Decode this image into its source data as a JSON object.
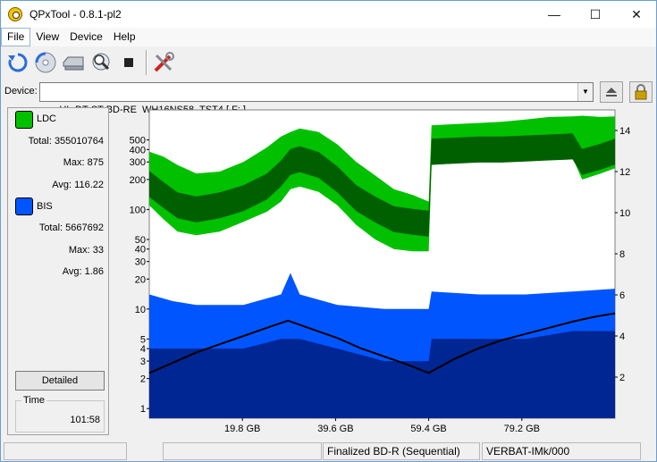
{
  "window": {
    "title": "QPxTool - 0.8.1-pl2"
  },
  "titlebar_buttons": {
    "minimize": "—",
    "maximize": "☐",
    "close": "✕"
  },
  "menu": [
    {
      "label": "File"
    },
    {
      "label": "View"
    },
    {
      "label": "Device"
    },
    {
      "label": "Help"
    }
  ],
  "toolbar": {
    "icons": [
      "refresh-icon",
      "disc-scan-icon",
      "drive-info-icon",
      "magnify-icon",
      "stop-icon",
      "settings-tools-icon"
    ]
  },
  "device": {
    "label": "Device:",
    "selected": "HL-DT-ST BD-RE  WH16NS58  TST4 [ F: ]"
  },
  "stats": {
    "ldc": {
      "label": "LDC",
      "color": "#00c000",
      "total_label": "Total:",
      "total": "355010764",
      "max_label": "Max:",
      "max": "875",
      "avg_label": "Avg:",
      "avg": "116.22"
    },
    "bis": {
      "label": "BIS",
      "color": "#0055ff",
      "total_label": "Total:",
      "total": "5667692",
      "max_label": "Max:",
      "max": "33",
      "avg_label": "Avg:",
      "avg": "1.86"
    },
    "detailed_label": "Detailed",
    "time_label": "Time",
    "time": "101:58"
  },
  "chart_data": {
    "type": "area",
    "x_ticks": [
      "19.8 GB",
      "39.6 GB",
      "59.4 GB",
      "79.2 GB"
    ],
    "x_tick_values": [
      19.8,
      39.6,
      59.4,
      79.2
    ],
    "xlim": [
      0,
      99
    ],
    "ylim_left": [
      0.8,
      1000
    ],
    "y_scale_left": "log",
    "y_ticks_left": [
      "1",
      "2",
      "3",
      "4",
      "5",
      "10",
      "20",
      "30",
      "40",
      "50",
      "100",
      "200",
      "300",
      "400",
      "500"
    ],
    "y_tick_values_left": [
      1,
      2,
      3,
      4,
      5,
      10,
      20,
      30,
      40,
      50,
      100,
      200,
      300,
      400,
      500
    ],
    "ylim_right": [
      0,
      15
    ],
    "y_ticks_right": [
      "2",
      "4",
      "6",
      "8",
      "10",
      "12",
      "14"
    ],
    "y_tick_values_right": [
      2,
      4,
      6,
      8,
      10,
      12,
      14
    ],
    "colors": {
      "ldc": "#00c000",
      "ldc_avg": "#006000",
      "bis": "#0055ff",
      "bis_avg": "#001e80",
      "speed": "#000000"
    },
    "series": [
      {
        "name": "LDC",
        "x": [
          0,
          3,
          6,
          10,
          15,
          20,
          25,
          28,
          30,
          32,
          36,
          40,
          44,
          48,
          52,
          56,
          59.4,
          60,
          65,
          70,
          75,
          80,
          85,
          90,
          92,
          96,
          99
        ],
        "max": [
          380,
          340,
          280,
          230,
          240,
          300,
          420,
          540,
          600,
          650,
          600,
          450,
          300,
          220,
          160,
          140,
          120,
          700,
          720,
          740,
          760,
          800,
          850,
          860,
          875,
          850,
          860
        ],
        "avg": [
          180,
          140,
          110,
          100,
          110,
          130,
          170,
          230,
          300,
          320,
          280,
          200,
          130,
          100,
          80,
          75,
          72,
          380,
          390,
          400,
          400,
          410,
          420,
          430,
          300,
          340,
          380
        ],
        "min": [
          110,
          80,
          60,
          55,
          60,
          75,
          95,
          120,
          160,
          170,
          150,
          110,
          70,
          50,
          40,
          38,
          38,
          280,
          290,
          300,
          300,
          310,
          320,
          330,
          200,
          230,
          260
        ]
      },
      {
        "name": "BIS",
        "x": [
          0,
          5,
          10,
          20,
          28,
          30,
          32,
          40,
          50,
          59.4,
          60,
          70,
          80,
          90,
          99
        ],
        "max": [
          14,
          12,
          11,
          11,
          14,
          23,
          14,
          11,
          10,
          10,
          15,
          14,
          14,
          15,
          16
        ],
        "avg": [
          4,
          4,
          4,
          4,
          5,
          5,
          5,
          4,
          3,
          3,
          5,
          5,
          5,
          6,
          6
        ]
      },
      {
        "name": "Speed",
        "x": [
          0,
          5,
          10,
          15,
          20,
          25,
          29.5,
          35,
          40,
          45,
          50,
          55,
          59.4,
          65,
          70,
          75,
          80,
          85,
          90,
          95,
          99
        ],
        "values": [
          2.2,
          2.7,
          3.2,
          3.6,
          4.0,
          4.4,
          4.75,
          4.3,
          3.9,
          3.4,
          3.0,
          2.6,
          2.2,
          2.9,
          3.4,
          3.8,
          4.1,
          4.4,
          4.7,
          4.95,
          5.1
        ]
      }
    ]
  },
  "status": {
    "cell1": "",
    "cell2": "",
    "cell3": "Finalized BD-R (Sequential)",
    "cell4": "VERBAT-IMk/000"
  }
}
